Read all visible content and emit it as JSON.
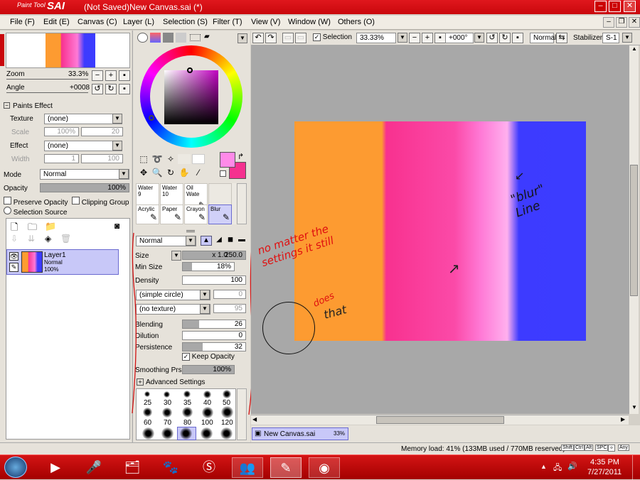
{
  "window": {
    "logo_small": "Paint Tool",
    "logo_big": "SAI",
    "title": "(Not Saved)New Canvas.sai (*)",
    "min": "–",
    "max": "□",
    "close": "✕"
  },
  "menu": {
    "items": [
      "File (F)",
      "Edit (E)",
      "Canvas (C)",
      "Layer (L)",
      "Selection (S)",
      "Filter (T)",
      "View (V)",
      "Window (W)",
      "Others (O)"
    ]
  },
  "toolbar": {
    "selection_label": "Selection",
    "zoom": "33.33%",
    "angle": "+000°",
    "blend": "Normal",
    "stabilizer_label": "Stabilizer",
    "stabilizer_value": "S-1"
  },
  "navigator": {
    "zoom_label": "Zoom",
    "zoom_value": "33.3%",
    "angle_label": "Angle",
    "angle_value": "+0008"
  },
  "paints_effect": {
    "header": "Paints Effect",
    "texture_label": "Texture",
    "texture_value": "(none)",
    "scale_label": "Scale",
    "scale_value": "100%",
    "scale_right": "20",
    "effect_label": "Effect",
    "effect_value": "(none)",
    "width_label": "Width",
    "width_value": "1",
    "width_right": "100"
  },
  "layer_opts": {
    "mode_label": "Mode",
    "mode_value": "Normal",
    "opacity_label": "Opacity",
    "opacity_value": "100%",
    "opacity_fraction": 1.0,
    "preserve": "Preserve Opacity",
    "clipping": "Clipping Group",
    "selection_source": "Selection Source"
  },
  "layer": {
    "name": "Layer1",
    "mode": "Normal",
    "opacity": "100%"
  },
  "brushes": {
    "row1": [
      "Water",
      "Water",
      "Oil Wate"
    ],
    "row1_sub": [
      "9",
      "10",
      ""
    ],
    "row2": [
      "Acrylic",
      "Paper",
      "Crayon",
      "Blur"
    ]
  },
  "brush_settings": {
    "mode": "Normal",
    "size_label": "Size",
    "size_mult": "x 1.0",
    "size_value": "250.0",
    "minsize_label": "Min Size",
    "minsize_value": "18%",
    "minsize_fraction": 0.18,
    "density_label": "Density",
    "density_value": "100",
    "shape": "(simple circle)",
    "shape_num": "0",
    "texture": "(no texture)",
    "texture_num": "95",
    "blending_label": "Blending",
    "blending_value": "26",
    "blending_fraction": 0.26,
    "dilution_label": "Dilution",
    "dilution_value": "0",
    "dilution_fraction": 0.0,
    "persistence_label": "Persistence",
    "persistence_value": "32",
    "persistence_fraction": 0.32,
    "keep_opacity": "Keep Opacity",
    "smoothing_label": "Smoothing Prs",
    "smoothing_value": "100%",
    "smoothing_fraction": 1.0,
    "advanced": "Advanced Settings"
  },
  "sizes": {
    "row1": [
      "25",
      "30",
      "35",
      "40",
      "50"
    ],
    "row2": [
      "60",
      "70",
      "80",
      "100",
      "120"
    ]
  },
  "annotations": {
    "no_matter": "no matter the settings it still",
    "does": "does",
    "that": "that",
    "blur_line": "\"blur\" Line",
    "arrow": "↗",
    "arrow2": "↙"
  },
  "canvas_tab": {
    "name": "New Canvas.sai",
    "zoom": "33%"
  },
  "status": {
    "memory": "Memory load: 41% (133MB used / 770MB reserved)",
    "keys": [
      "Shift",
      "Ctrl",
      "Alt",
      "SPC",
      "✧",
      "Any"
    ]
  },
  "taskbar": {
    "time": "4:35 PM",
    "date": "7/27/2011"
  },
  "colors": {
    "primary": "#ff8ae8",
    "secondary": "#f5318f",
    "accent": "#c9070c"
  }
}
